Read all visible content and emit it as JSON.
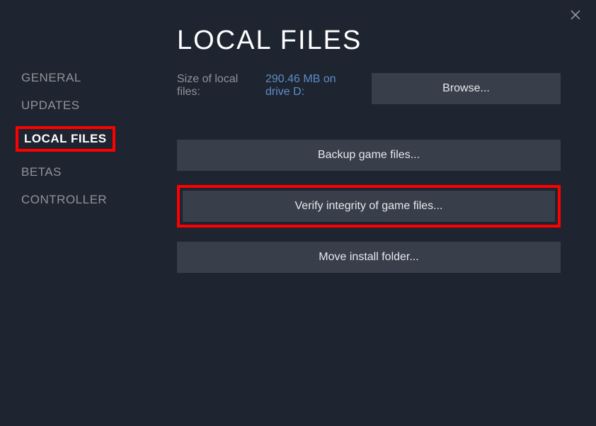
{
  "sidebar": {
    "items": [
      {
        "label": "GENERAL"
      },
      {
        "label": "UPDATES"
      },
      {
        "label": "LOCAL FILES"
      },
      {
        "label": "BETAS"
      },
      {
        "label": "CONTROLLER"
      }
    ]
  },
  "main": {
    "title": "LOCAL FILES",
    "size_label": "Size of local files:",
    "size_value": "290.46 MB on drive D:",
    "browse_label": "Browse...",
    "actions": {
      "backup": "Backup game files...",
      "verify": "Verify integrity of game files...",
      "move": "Move install folder..."
    }
  }
}
